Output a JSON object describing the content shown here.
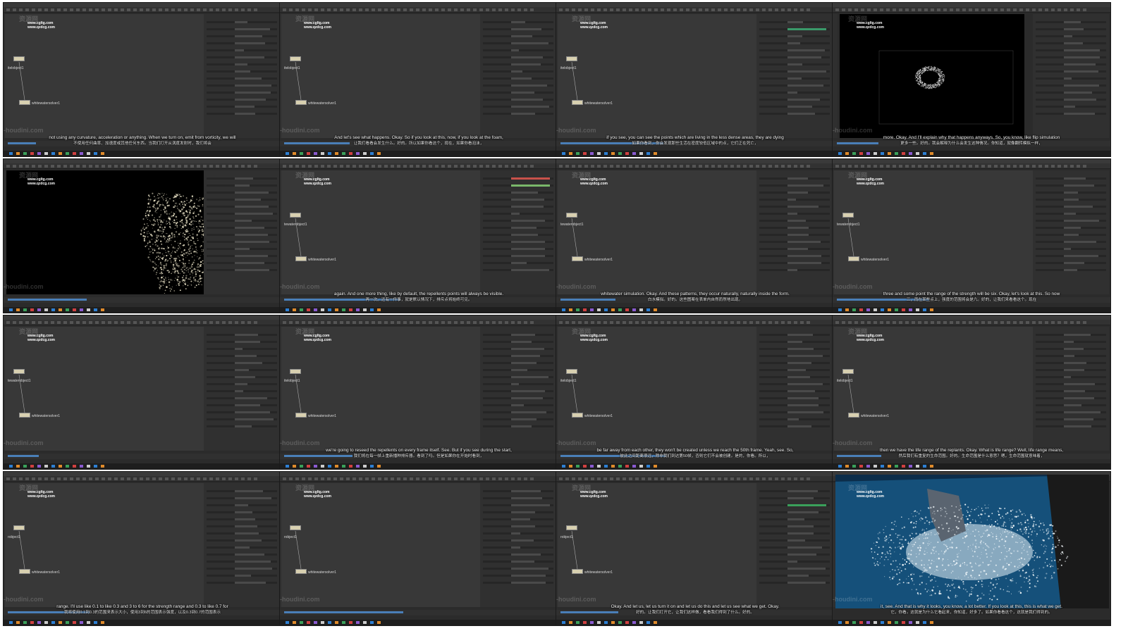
{
  "watermarks": {
    "site1": "www.cgltg.com",
    "site2": "www.qzdcg.com",
    "big1": "资源网",
    "big2": "ae-houdini.com"
  },
  "nodes": {
    "whitewatersolver": "whitewatersolver1",
    "whitewaterobject": "tewaterobject1",
    "robject": "robject1",
    "object": "itelobject1"
  },
  "subtitles": [
    {
      "en": "not using any curvature, acceleration or anything. When we turn on, emit from vorticity, we will",
      "zh": "不使用任何曲率、加速度或其他任何东西。当我们打开从涡度发射时，我们将会"
    },
    {
      "en": "And let's see what happens. Okay. So if you look at this, now, if you look at the foam,",
      "zh": "让我们看看会发生什么。好的。所以如果你看这个，现在，如果你看泡沫，"
    },
    {
      "en": "if you see, you can see the points which are living in the less dense areas, they are dying",
      "zh": "如果你看到，你会发现那些生活在密度较低区域中的点，它们正在死亡，"
    },
    {
      "en": "more. Okay. And I'll explain why that happens anyways. So, you know, like flip simulation",
      "zh": "更多一些。好的。我会解释为什么会发生这种情况。你知道，就像翻转模拟一样，"
    },
    {
      "en": "",
      "zh": ""
    },
    {
      "en": "again. And one more thing, like by default, the repellents points will always be visible.",
      "zh": "再一次。还有一件事，就是默认情况下，排斥点将始终可见。"
    },
    {
      "en": "whitewater simulation. Okay. And these patterns, they occur naturally, naturally inside the form.",
      "zh": "白水模拟。好的。这些图案在表单内自然而然地出现。"
    },
    {
      "en": "three and some point the range of the strength will be six. Okay, let's look at this. So now",
      "zh": "三，而在某些点上，强度的范围将会是六。好的，让我们来看看这个。现在"
    },
    {
      "en": "",
      "zh": ""
    },
    {
      "en": "we're going to reseed the repellents on every frame itself. See. But if you see during the start,",
      "zh": "我们将在每一帧上重新播种排斥器。看到了吗。但是如果你在开始时看到，"
    },
    {
      "en": "be far away from each other, they won't be created unless we reach the 50th frame. Yeah, see. So,",
      "zh": "彼此之间距离很远，除非我们到达第50帧，否则它们不会被创建。是的，你看。所以，"
    },
    {
      "en": "then we have the life range of the replants. Okay. What is life range? Well, life range means,",
      "zh": "然后我们有重复的生命范围。好的。生命范围是什么意思？嗯，生命范围就意味着，"
    },
    {
      "en": "range. I'll use like 0.1 to like 0.3 and 3 to 6 for the strength range and 0.3 to like 0.7 for",
      "zh": "我将使用0.1到0.3的范围来表示大小，使用3到6的范围表示强度，以及0.3到0.7的范围表示"
    },
    {
      "en": "",
      "zh": ""
    },
    {
      "en": "Okay. And let us, let us turn it on and let us do this and let us see what we get. Okay.",
      "zh": "好的。让我们打开它，让我们这样做，看看我们得到了什么。好的。"
    },
    {
      "en": "it, see. And that is why it looks, you know, a lot better. If you look at this, this is what we get.",
      "zh": "它，你看。这就是为什么它看起来，你知道，好多了。如果你看看这个，这就是我们得到的。"
    }
  ]
}
